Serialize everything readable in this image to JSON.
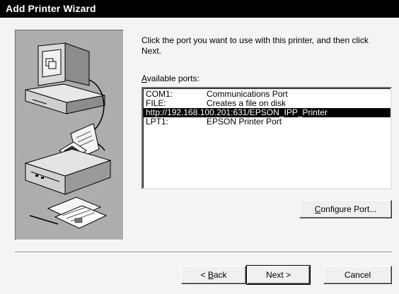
{
  "window": {
    "title": "Add Printer Wizard"
  },
  "instructions": "Click the port you want to use with this printer, and then click Next.",
  "ports_label": {
    "accel": "A",
    "rest": "vailable ports:"
  },
  "ports": [
    {
      "port": "COM1:",
      "description": "Communications Port",
      "selected": false
    },
    {
      "port": "FILE:",
      "description": "Creates a file on disk",
      "selected": false
    },
    {
      "port": "http://192.168.100.201:631/EPSON_IPP_Printer",
      "description": "",
      "selected": true
    },
    {
      "port": "LPT1:",
      "description": "EPSON Printer Port",
      "selected": false
    }
  ],
  "buttons": {
    "configure_port": {
      "accel": "C",
      "rest": "onfigure Port..."
    },
    "back": {
      "prefix": "< ",
      "accel": "B",
      "rest": "ack"
    },
    "next": "Next >",
    "cancel": "Cancel"
  },
  "colors": {
    "titlebar": "#000000",
    "dialog_bg": "#f4f4f4",
    "illustration_bg": "#adadad",
    "selection": "#000000"
  },
  "icons": [
    "computer-icon",
    "printer-icon",
    "documents-icon"
  ]
}
